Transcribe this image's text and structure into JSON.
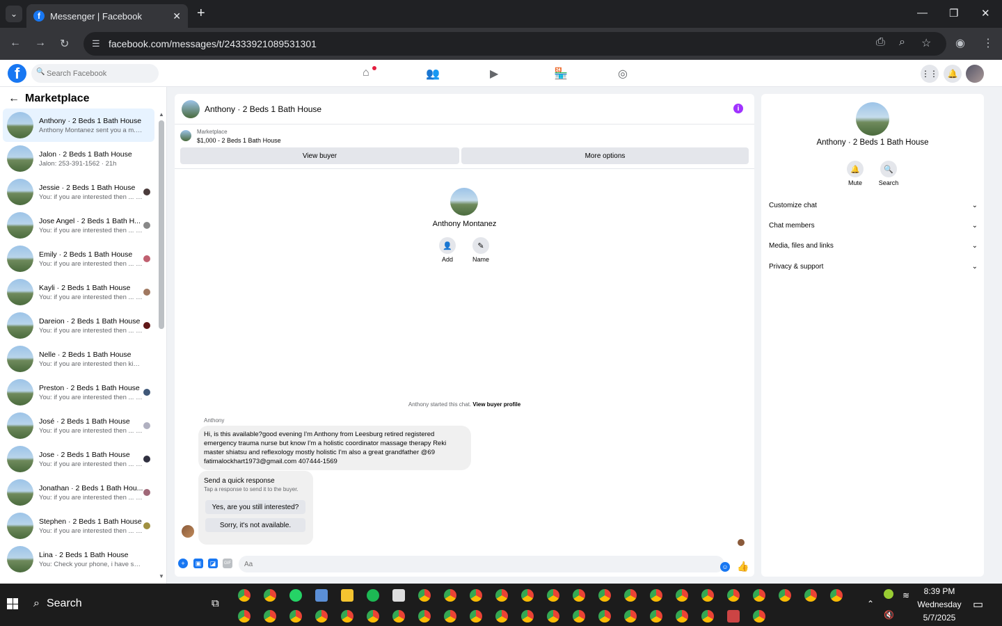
{
  "browser": {
    "tab_title": "Messenger | Facebook",
    "url": "facebook.com/messages/t/24333921089531301"
  },
  "fb": {
    "search_placeholder": "Search Facebook"
  },
  "sidebar": {
    "title": "Marketplace",
    "conversations": [
      {
        "name": "Anthony · 2 Beds 1 Bath House",
        "preview": "Anthony Montanez sent you a m... · 15h",
        "active": true
      },
      {
        "name": "Jalon · 2 Beds 1 Bath House",
        "preview": "Jalon: 253-391-1562 · 21h"
      },
      {
        "name": "Jessie · 2 Beds 1 Bath House",
        "preview": "You: if you are interested then ... · 4d"
      },
      {
        "name": "Jose Angel · 2 Beds 1 Bath H...",
        "preview": "You: if you are interested then ... · 4d"
      },
      {
        "name": "Emily · 2 Beds 1 Bath House",
        "preview": "You: if you are interested then ... · 4d"
      },
      {
        "name": "Kayli · 2 Beds 1 Bath House",
        "preview": "You: if you are interested then ... · 4d"
      },
      {
        "name": "Dareion · 2 Beds 1 Bath House",
        "preview": "You: if you are interested then ... · 4d"
      },
      {
        "name": "Nelle · 2 Beds 1 Bath House",
        "preview": "You: if you are interested then kin... · 4d"
      },
      {
        "name": "Preston · 2 Beds 1 Bath House",
        "preview": "You: if you are interested then ... · 4d"
      },
      {
        "name": "José · 2 Beds 1 Bath House",
        "preview": "You: if you are interested then ... · 4d"
      },
      {
        "name": "Jose · 2 Beds 1 Bath House",
        "preview": "You: if you are interested then ... · 4d"
      },
      {
        "name": "Jonathan · 2 Beds 1 Bath Hou...",
        "preview": "You: if you are interested then ... · 4d"
      },
      {
        "name": "Stephen · 2 Beds 1 Bath House",
        "preview": "You: if you are interested then ... · 4d"
      },
      {
        "name": "Lina · 2 Beds 1 Bath House",
        "preview": "You: Check your phone, i have sen... · 6d"
      }
    ]
  },
  "chat": {
    "title": "Anthony · 2 Beds 1 Bath House",
    "marketplace_label": "Marketplace",
    "listing": "$1,000 - 2 Beds 1 Bath House",
    "view_buyer": "View buyer",
    "more_options": "More options",
    "profile_name": "Anthony Montanez",
    "add_label": "Add",
    "name_label": "Name",
    "started_text": "Anthony started this chat.",
    "view_buyer_profile": "View buyer profile",
    "sender": "Anthony",
    "message": "Hi, is this available?good evening I'm Anthony from Leesburg retired registered emergency trauma nurse but know I'm a holistic coordinator massage therapy Reki master shiatsu and reflexology mostly holistic I'm also a great grandfather @69 fatimalockhart1973@gmail.com 407444-1569",
    "quick_title": "Send a quick response",
    "quick_sub": "Tap a response to send it to the buyer.",
    "quick_yes": "Yes, are you still interested?",
    "quick_no": "Sorry, it's not available.",
    "composer_placeholder": "Aa"
  },
  "right": {
    "name": "Anthony · 2 Beds 1 Bath House",
    "mute": "Mute",
    "search": "Search",
    "items": [
      "Customize chat",
      "Chat members",
      "Media, files and links",
      "Privacy & support"
    ]
  },
  "taskbar": {
    "search": "Search",
    "time": "8:39 PM",
    "day": "Wednesday",
    "date": "5/7/2025"
  },
  "colors": {
    "fb_blue": "#1877f2",
    "active_conv": "#e7f3ff",
    "info_purple": "#a033ff"
  }
}
